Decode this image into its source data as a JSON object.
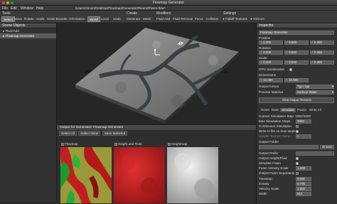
{
  "window": {
    "title": "Flowmap Generator"
  },
  "menu": {
    "items": [
      "File",
      "Edit",
      "Window",
      "Help"
    ],
    "path": "/Users/simon/Desktop/Flowmap/Generator/Rivers/Rivers.flow*"
  },
  "toolbar": {
    "tools_label": "Tools",
    "create_label": "Create",
    "modifiers_label": "Modifiers",
    "settings_label": "Settings",
    "tools": [
      "Select",
      "Move",
      "Rotate",
      "Scale",
      "Scale Bounds",
      "Orientation",
      "World",
      "Local",
      "Undo"
    ],
    "create": [
      "Generate",
      "Mesh"
    ],
    "modifiers": [
      "Fluid Add",
      "Fluid Remove",
      "Force",
      "Collision"
    ],
    "settings": [
      "Falloff Textures",
      "Gizmos"
    ]
  },
  "scene": {
    "title": "Scene Objects",
    "items": [
      "Fluid Add",
      "Flowmap Generator"
    ]
  },
  "output": {
    "title": "Output for Generator: Flowmap Generator",
    "buttons": [
      "Select All",
      "Select None",
      "Save Selected"
    ],
    "thumbs": [
      "Flowmap",
      "Height and Fluid",
      "Heightmap"
    ]
  },
  "inspector": {
    "title": "Inspector",
    "object_name": "Flowmap Generator",
    "position_label": "Position",
    "position": {
      "x": "0.000",
      "y": "0.000",
      "z": "0.000"
    },
    "rotation_label": "Rotation",
    "rotation": {
      "x": "0.000",
      "y": "0.000",
      "z": "0.000"
    },
    "scale_label": "Scale",
    "scale": {
      "x": "0.000",
      "y": "0.000",
      "z": "0.000"
    },
    "gpu_label": "GPU acceleration",
    "dimensions_label": "Dimensions",
    "dimensions": {
      "x": "10.000",
      "y": "10.000"
    },
    "output_format_label": "Output format",
    "output_format": "Tga / tga",
    "preview_label": "Preview Material",
    "preview": "Surface Water",
    "view_output_button": "View Output Textures",
    "tabs": [
      "Reset",
      "Bake",
      "Simulate",
      "Pause",
      "Write All"
    ],
    "current_steps_label": "Current Simulation Step: 1062/2000",
    "max_steps_label": "Max Simulation Steps",
    "max_steps": "2000",
    "continuous_label": "Continuous Simulation",
    "write_max_label": "Write to file on max steps",
    "update_delay_label": "Update Texture Delay",
    "update_delay": "5",
    "output_folder_label": "Output Folder",
    "browse_label": "Browse",
    "output_prefix_label": "Output Prefix",
    "output_heightfluid_label": "Output Height/Fluid",
    "simulate_foam_label": "Simulate Foam",
    "foam_velocity_label": "Foam Velocity Scale",
    "foam_velocity": "1.000",
    "output_foam_label": "Output Foam Separately",
    "timestep_label": "Timestep",
    "timestep": "0.280",
    "gravity_label": "Gravity",
    "gravity": "0.700",
    "velocity_label": "Velocity Scale",
    "velocity": "1.000",
    "width_label": "Width",
    "width": "512"
  }
}
